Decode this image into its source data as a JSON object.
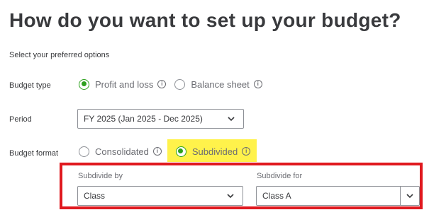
{
  "page": {
    "title": "How do you want to set up your budget?",
    "subtitle": "Select your preferred options"
  },
  "budget_type": {
    "label": "Budget type",
    "options": [
      {
        "label": "Profit and loss",
        "selected": true
      },
      {
        "label": "Balance sheet",
        "selected": false
      }
    ]
  },
  "period": {
    "label": "Period",
    "value": "FY 2025 (Jan 2025 - Dec 2025)"
  },
  "budget_format": {
    "label": "Budget format",
    "options": [
      {
        "label": "Consolidated",
        "selected": false
      },
      {
        "label": "Subdivided",
        "selected": true
      }
    ]
  },
  "subdivide_by": {
    "label": "Subdivide by",
    "value": "Class"
  },
  "subdivide_for": {
    "label": "Subdivide for",
    "value": "Class A"
  },
  "colors": {
    "accent": "#2ca01c",
    "highlight": "#fff24b",
    "annotation": "#e0191f"
  },
  "icons": {
    "info": "info-icon",
    "dropdown": "chevron-down-icon"
  }
}
